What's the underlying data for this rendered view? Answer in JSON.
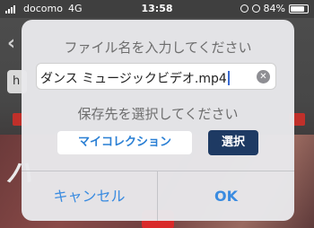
{
  "status_bar": {
    "carrier": "docomo",
    "network": "4G",
    "time": "13:58",
    "battery": "84%",
    "battery_level": 0.84
  },
  "background": {
    "field_partial_text": "h",
    "large_text_partial": "ハ"
  },
  "dialog": {
    "title": "ファイル名を入力してください",
    "filename_value": "ダンス ミュージックビデオ.mp4",
    "clear_icon": "clear-circle-icon",
    "subtitle": "保存先を選択してください",
    "collection_label": "マイコレクション",
    "select_label": "選択",
    "cancel_label": "キャンセル",
    "ok_label": "OK",
    "colors": {
      "action_blue": "#3a8be0",
      "select_button_bg": "#1e3a63"
    }
  }
}
